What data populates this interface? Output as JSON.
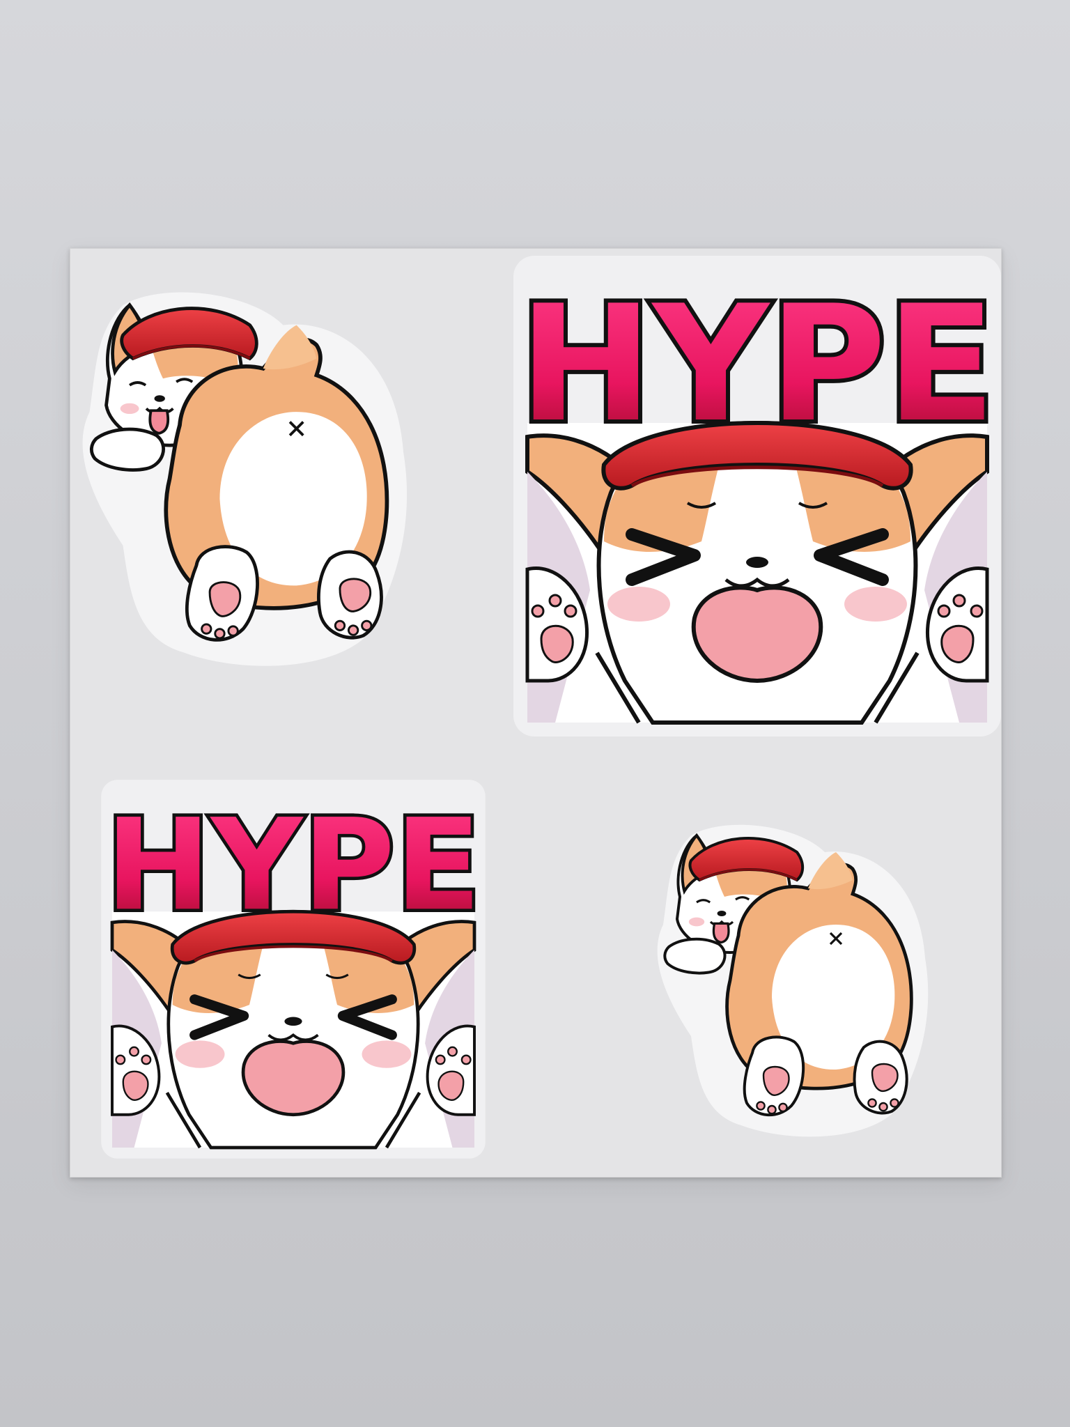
{
  "stickers": [
    {
      "kind": "corgi-butt",
      "label": ""
    },
    {
      "kind": "hype-corgi",
      "label": "HYPE"
    },
    {
      "kind": "hype-corgi",
      "label": "HYPE"
    },
    {
      "kind": "corgi-butt",
      "label": ""
    }
  ],
  "colors": {
    "fur_orange": "#f2b07c",
    "fur_white": "#ffffff",
    "cap_red": "#d8262b",
    "hype_pink": "#e8155f",
    "hype_dark": "#a80c2c",
    "paw_pink": "#f3a0a8",
    "outline": "#111111",
    "sheet": "#e4e4e6"
  }
}
